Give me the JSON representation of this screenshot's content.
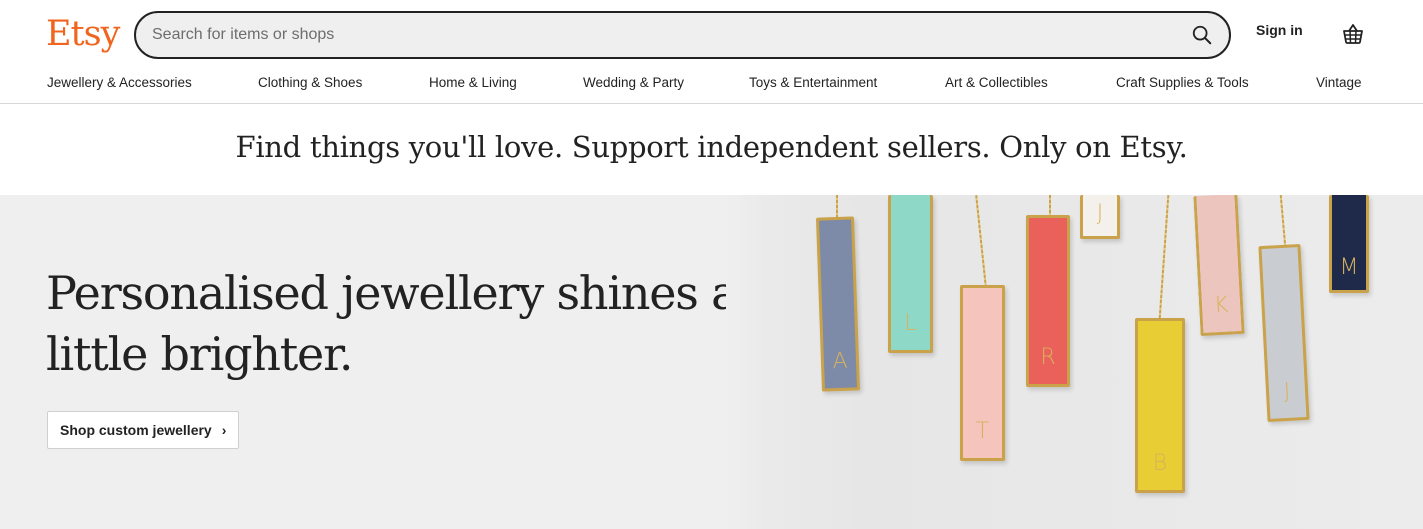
{
  "header": {
    "logo": "Etsy",
    "search_placeholder": "Search for items or shops",
    "sign_in": "Sign in"
  },
  "categories": [
    "Jewellery & Accessories",
    "Clothing & Shoes",
    "Home & Living",
    "Wedding & Party",
    "Toys & Entertainment",
    "Art & Collectibles",
    "Craft Supplies & Tools",
    "Vintage"
  ],
  "tagline": "Find things you'll love. Support independent sellers. Only on Etsy.",
  "hero": {
    "title": "Personalised jewellery shines a little brighter.",
    "button_label": "Shop custom jewellery",
    "button_chevron": "›"
  },
  "pendants": [
    {
      "letter": "A",
      "color": "#7d8aa8"
    },
    {
      "letter": "L",
      "color": "#8ed8c7"
    },
    {
      "letter": "T",
      "color": "#f5c4bd"
    },
    {
      "letter": "J",
      "color": "#f4f1ec"
    },
    {
      "letter": "R",
      "color": "#e9615a"
    },
    {
      "letter": "B",
      "color": "#e9cd34"
    },
    {
      "letter": "K",
      "color": "#ecc6be"
    },
    {
      "letter": "J",
      "color": "#c9cdd2"
    },
    {
      "letter": "M",
      "color": "#1f2a4a"
    }
  ],
  "colors": {
    "brand": "#f1641e",
    "hero_bg": "#efefef"
  }
}
